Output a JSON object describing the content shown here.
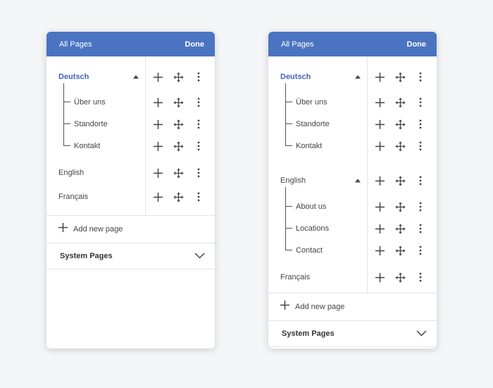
{
  "panels": [
    {
      "header": {
        "title": "All Pages",
        "done_label": "Done"
      },
      "rows": [
        {
          "label": "Deutsch",
          "active": true,
          "expanded": true
        },
        {
          "label": "Über uns",
          "child": true
        },
        {
          "label": "Standorte",
          "child": true
        },
        {
          "label": "Kontakt",
          "child": true
        },
        {
          "label": "English"
        },
        {
          "label": "Français"
        }
      ],
      "add_page_label": "Add new page",
      "system_pages_label": "System Pages"
    },
    {
      "header": {
        "title": "All Pages",
        "done_label": "Done"
      },
      "rows": [
        {
          "label": "Deutsch",
          "active": true,
          "expanded": true
        },
        {
          "label": "Über uns",
          "child": true
        },
        {
          "label": "Standorte",
          "child": true
        },
        {
          "label": "Kontakt",
          "child": true
        },
        {
          "label": "English",
          "expanded": true
        },
        {
          "label": "About us",
          "child": true
        },
        {
          "label": "Locations",
          "child": true
        },
        {
          "label": "Contact",
          "child": true
        },
        {
          "label": "Français"
        }
      ],
      "add_page_label": "Add new page",
      "system_pages_label": "System Pages"
    }
  ],
  "icons": {
    "add": "plus-icon",
    "move": "move-arrows-icon",
    "menu": "more-vertical-icon",
    "expand": "caret-up-icon",
    "system": "chevron-down-icon"
  },
  "colors": {
    "header_bg": "#4a74c2",
    "active_text": "#3e67b6",
    "background": "#f4f5f7"
  }
}
